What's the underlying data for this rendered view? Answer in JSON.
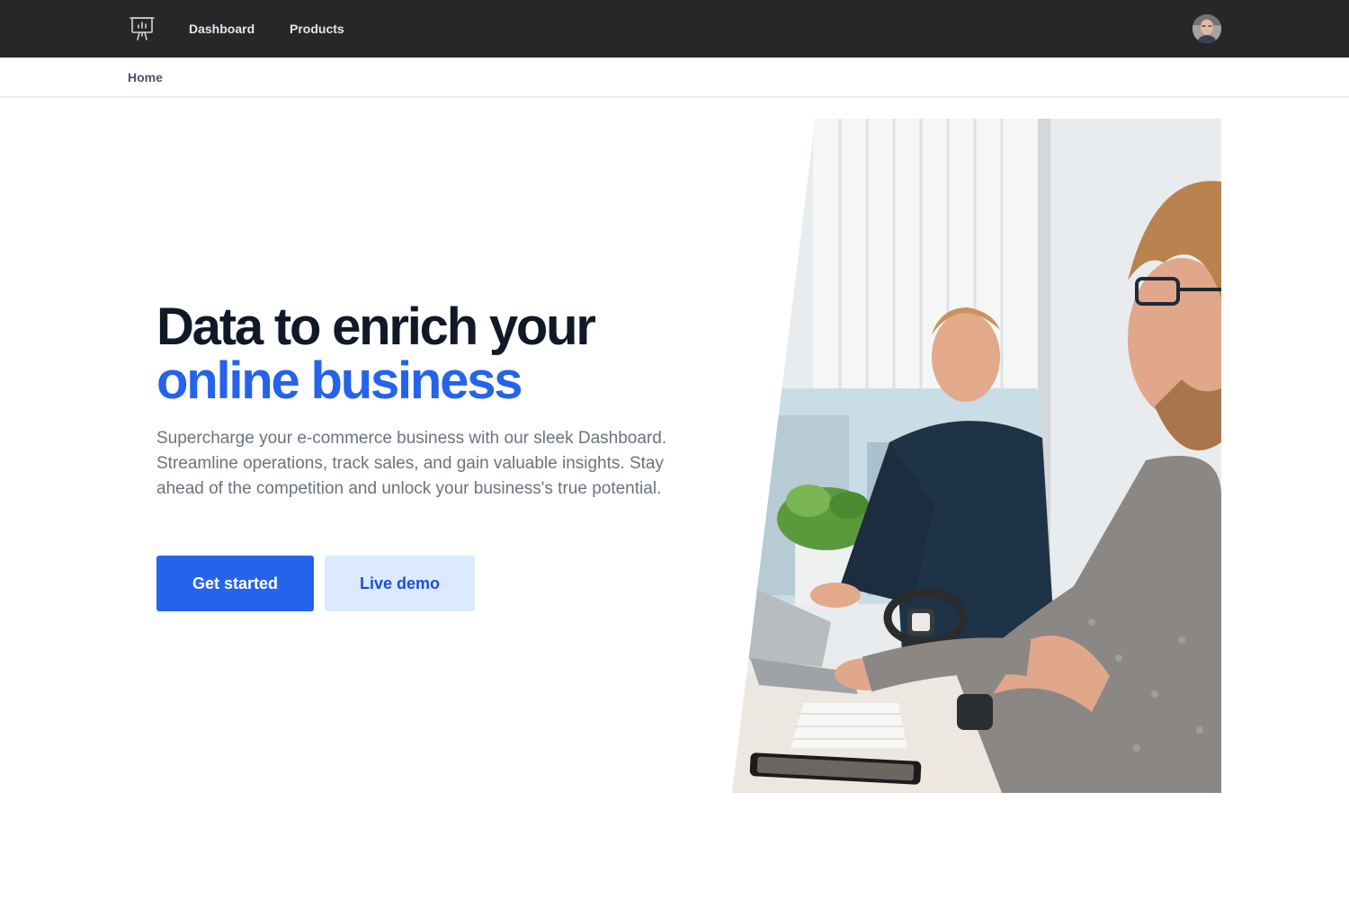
{
  "nav": {
    "logo_icon": "presentation-chart-icon",
    "links": [
      {
        "label": "Dashboard"
      },
      {
        "label": "Products"
      }
    ],
    "avatar_icon": "user-avatar"
  },
  "breadcrumb": {
    "current": "Home"
  },
  "hero": {
    "title_line1": "Data to enrich your",
    "title_line2": "online business",
    "description": "Supercharge your e-commerce business with our sleek Dashboard. Streamline operations, track sales, and gain valuable insights. Stay ahead of the competition and unlock your business's true potential.",
    "primary_button": "Get started",
    "secondary_button": "Live demo",
    "image_alt": "two-men-working-at-computers-photo"
  },
  "colors": {
    "navbar_bg": "#27272a",
    "accent": "#2563eb",
    "accent_light": "#dbeafe",
    "heading": "#111827",
    "body_text": "#6b7280"
  }
}
